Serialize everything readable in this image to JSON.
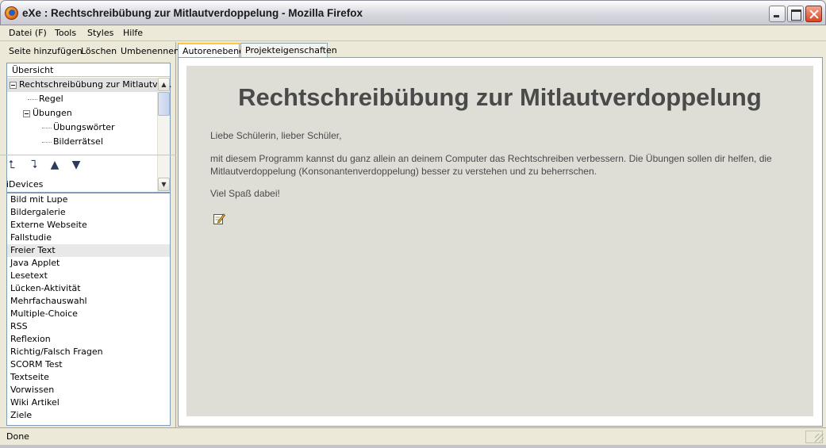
{
  "window": {
    "title": "eXe : Rechtschreibübung zur Mitlautverdoppelung - Mozilla Firefox"
  },
  "menu": {
    "items": [
      "Datei (F)",
      "Tools",
      "Styles",
      "Hilfe"
    ]
  },
  "outline_toolbar": {
    "add": "Seite hinzufügen",
    "delete": "Löschen",
    "rename": "Umbenennen"
  },
  "outline": {
    "header": "Übersicht",
    "nodes": [
      {
        "label": "Rechtschreibübung zur Mitlautve…",
        "selected": true
      },
      {
        "label": "Regel"
      },
      {
        "label": "Übungen"
      },
      {
        "label": "Übungswörter"
      },
      {
        "label": "Bilderrätsel"
      }
    ]
  },
  "idevices": {
    "label": "iDevices",
    "items": [
      "Bild mit Lupe",
      "Bildergalerie",
      "Externe Webseite",
      "Fallstudie",
      "Freier Text",
      "Java Applet",
      "Lesetext",
      "Lücken-Aktivität",
      "Mehrfachauswahl",
      "Multiple-Choice",
      "RSS",
      "Reflexion",
      "Richtig/Falsch Fragen",
      "SCORM Test",
      "Textseite",
      "Vorwissen",
      "Wiki Artikel",
      "Ziele"
    ],
    "highlighted_index": 4
  },
  "tabs": {
    "authoring": "Autorenebene",
    "properties": "Projekteigenschaften",
    "active": "authoring"
  },
  "content": {
    "title": "Rechtschreibübung zur Mitlautverdoppelung",
    "greeting": "Liebe Schülerin, lieber Schüler,",
    "body": "mit diesem Programm kannst du ganz allein an deinem Computer das Rechtschreiben verbessern. Die Übungen sollen dir helfen, die Mitlautverdoppelung (Konsonantenverdoppelung) besser zu verstehen und zu beherrschen.",
    "closing": "Viel Spaß dabei!",
    "edit_icon": "edit-pencil-icon"
  },
  "status": {
    "text": "Done"
  },
  "colors": {
    "content_bg": "#deded6",
    "title_text": "#4a4a4a",
    "active_tab_accent": "#ffc83c"
  }
}
